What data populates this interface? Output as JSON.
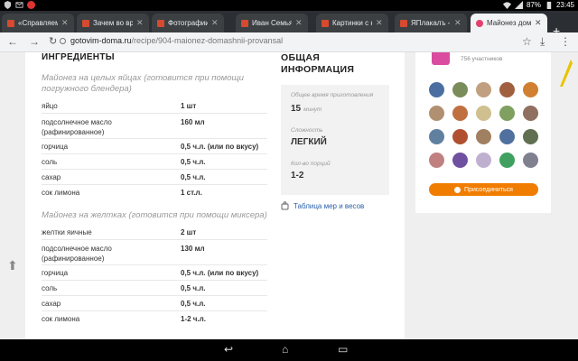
{
  "statusbar": {
    "battery": "87%",
    "time": "23:45"
  },
  "tabs": [
    {
      "title": "«Справляемся"
    },
    {
      "title": "Зачем во врем"
    },
    {
      "title": "Фотографии об"
    },
    {
      "title": "Иван Семьян. А"
    },
    {
      "title": "Картинки с над"
    },
    {
      "title": "ЯПлакалъ - Раз"
    },
    {
      "title": "Майонез дома"
    }
  ],
  "address": {
    "host": "gotovim-doma.ru",
    "path": "/recipe/904-maionez-domashnii-provansal"
  },
  "ingredients": {
    "heading": "ИНГРЕДИЕНТЫ",
    "section1": "Майонез на целых яйцах (готовится при помощи погружного блендера)",
    "rows1": [
      {
        "name": "яйцо",
        "qty": "1 шт"
      },
      {
        "name": "подсолнечное масло (рафинированное)",
        "qty": "160 мл"
      },
      {
        "name": "горчица",
        "qty": "0,5 ч.л. (или по вкусу)"
      },
      {
        "name": "соль",
        "qty": "0,5 ч.л."
      },
      {
        "name": "сахар",
        "qty": "0,5 ч.л."
      },
      {
        "name": "сок лимона",
        "qty": "1 ст.л."
      }
    ],
    "section2": "Майонез на желтках (готовится при помощи миксера)",
    "rows2": [
      {
        "name": "желтки яичные",
        "qty": "2 шт"
      },
      {
        "name": "подсолнечное масло (рафинированное)",
        "qty": "130 мл"
      },
      {
        "name": "горчица",
        "qty": "0,5 ч.л. (или по вкусу)"
      },
      {
        "name": "соль",
        "qty": "0,5 ч.л."
      },
      {
        "name": "сахар",
        "qty": "0,5 ч.л."
      },
      {
        "name": "сок лимона",
        "qty": "1-2 ч.л."
      }
    ]
  },
  "info": {
    "heading_line1": "ОБЩАЯ",
    "heading_line2": "ИНФОРМАЦИЯ",
    "time_label": "Общее время приготовления",
    "time_value": "15",
    "time_unit": "минут",
    "difficulty_label": "Сложность",
    "difficulty_value": "ЛЕГКИЙ",
    "portions_label": "Кол-во порций",
    "portions_value": "1-2",
    "table_link": "Таблица мер и весов"
  },
  "group": {
    "participants": "756 участников",
    "join_label": "Присоединиться",
    "avatar_colors": [
      "#4a6fa0",
      "#7a8c5a",
      "#c0a080",
      "#a06040",
      "#d08030",
      "#b09070",
      "#c07040",
      "#d0c090",
      "#80a060",
      "#907060",
      "#6080a0",
      "#b05030",
      "#a08060",
      "#5070a0",
      "#607050",
      "#c08080",
      "#7050a0",
      "#c0b0d0",
      "#40a060",
      "#808090"
    ]
  }
}
